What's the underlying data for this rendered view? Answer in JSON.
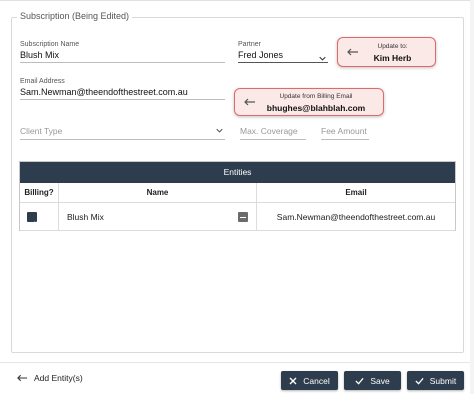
{
  "form": {
    "legend": "Subscription (Being Edited)",
    "subscription_name": {
      "label": "Subscription Name",
      "value": "Blush Mix"
    },
    "partner": {
      "label": "Partner",
      "value": "Fred Jones"
    },
    "email": {
      "label": "Email Address",
      "value": "Sam.Newman@theendofthestreet.com.au"
    },
    "client_type": {
      "placeholder": "Client Type"
    },
    "max_coverage": {
      "placeholder": "Max. Coverage"
    },
    "fee_amount": {
      "placeholder": "Fee Amount"
    }
  },
  "hints": {
    "partner_update": {
      "label": "Update to:",
      "value": "Kim Herb"
    },
    "email_update": {
      "label": "Update from Billing Email",
      "value": "bhughes@blahblah.com"
    }
  },
  "entities": {
    "title": "Entities",
    "columns": [
      "Billing?",
      "Name",
      "Email"
    ],
    "rows": [
      {
        "billing": true,
        "name": "Blush Mix",
        "email": "Sam.Newman@theendofthestreet.com.au"
      }
    ]
  },
  "footer": {
    "add_entity": "Add Entity(s)",
    "cancel": "Cancel",
    "save": "Save",
    "submit": "Submit"
  },
  "colors": {
    "primary": "#2d3d4e",
    "hint_border": "#e06a6a",
    "hint_bg": "#fbe9e8"
  }
}
